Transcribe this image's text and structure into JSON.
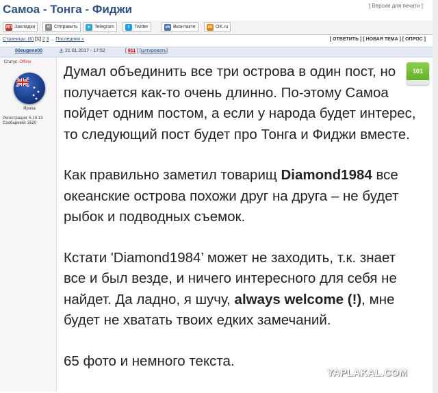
{
  "header": {
    "title": "Самоа - Тонга - Фиджи",
    "print_version": "[ Версия для печати ]"
  },
  "share": {
    "buttons": [
      {
        "label": "Закладки",
        "icon": "bookmark-icon",
        "color": "#c0392b",
        "glyph": "ЯП"
      },
      {
        "label": "Отправить",
        "icon": "mail-icon",
        "color": "#888888",
        "glyph": "✉"
      },
      {
        "label": "Telegram",
        "icon": "telegram-icon",
        "color": "#2ca5e0",
        "glyph": "➤"
      },
      {
        "label": "Twitter",
        "icon": "twitter-icon",
        "color": "#1da1f2",
        "glyph": "t"
      },
      {
        "label": "Вконтакте",
        "icon": "vk-icon",
        "color": "#4a76a8",
        "glyph": "vk"
      },
      {
        "label": "OK.ru",
        "icon": "ok-icon",
        "color": "#ee8208",
        "glyph": "ok"
      }
    ]
  },
  "nav": {
    "pages_label": "Страницы: (6)",
    "current": "[1]",
    "p2": "2",
    "p3": "3",
    "ellipsis": "...",
    "last": "Последняя »",
    "actions": "[ ОТВЕТИТЬ ] [ НОВАЯ ТЕМА ] [ ОПРОС ]"
  },
  "meta": {
    "author": "00eugene00",
    "date": "21.01.2017 - 17:52",
    "post_num": "911",
    "quote": "цитировать"
  },
  "sidebar": {
    "status_label": "Статус:",
    "status_value": "Offline",
    "rank": "Ярила",
    "registration": "Регистрация: 5.10.13",
    "messages": "Сообщений: 3520"
  },
  "post": {
    "p1": "Думал объединить все три острова в один пост, но получается как-то очень длинно. По-этому Самоа пойдет одним постом, а если у народа будет интерес, то следующий пост будет про Тонга и Фиджи вместе.",
    "p2_a": "Как правильно заметил товарищ ",
    "p2_b": "Diamond1984",
    "p2_c": " все океанские острова похожи друг на друга – не будет рыбок и подводных съемок.",
    "p3_a": "Кстати 'Diamond1984’ может не заходить, т.к. знает все и был везде, и ничего интересного для себя не найдет. Да ладно, я шучу, ",
    "p3_b": "always welcome (!)",
    "p3_c": ", мне будет не хватать твоих едких замечаний.",
    "p4": "65 фото и немного текста."
  },
  "rating": "101",
  "watermark": "YAPLAKAL.COM"
}
